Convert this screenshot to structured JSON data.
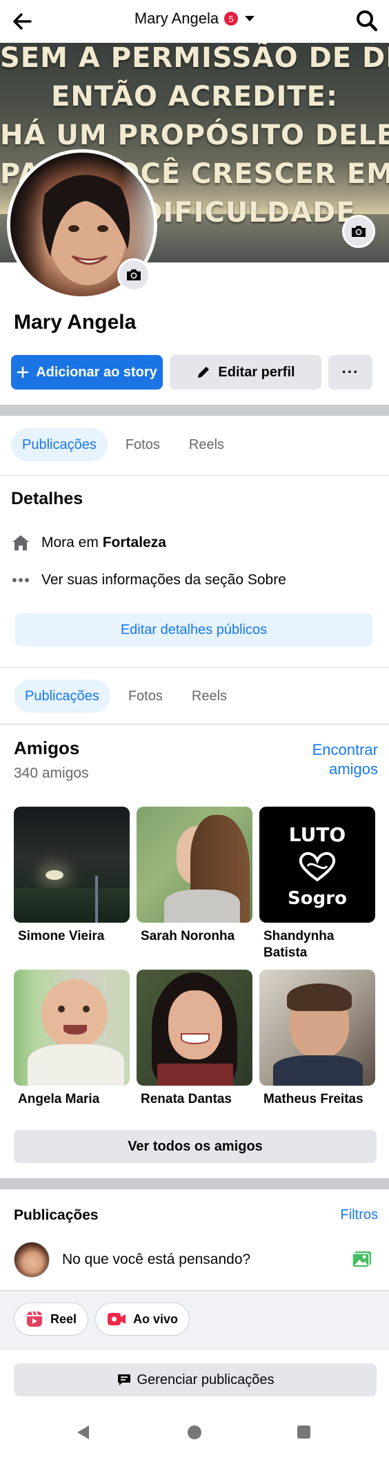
{
  "header": {
    "title": "Mary Angela",
    "notification_count": "5"
  },
  "cover": {
    "quote_lines": [
      "SEM A PERMISSÃO DE DEUS,",
      "ENTÃO ACREDITE:",
      "HÁ UM PROPÓSITO DELE",
      "PARA VOCÊ CRESCER EM",
      "DIFICULDADE."
    ]
  },
  "profile": {
    "name": "Mary Angela"
  },
  "actions": {
    "add_story": "Adicionar ao story",
    "edit_profile": "Editar perfil",
    "more": "···"
  },
  "tabs_top": [
    "Publicações",
    "Fotos",
    "Reels"
  ],
  "details": {
    "title": "Detalhes",
    "lives_in_prefix": "Mora em ",
    "lives_in_city": "Fortaleza",
    "about_link": "Ver suas informações da seção Sobre",
    "edit_button": "Editar detalhes públicos"
  },
  "tabs_mid": [
    "Publicações",
    "Fotos",
    "Reels"
  ],
  "friends": {
    "title": "Amigos",
    "count": "340 amigos",
    "find_link": "Encontrar amigos",
    "list": [
      {
        "name": "Simone Vieira"
      },
      {
        "name": "Sarah Noronha"
      },
      {
        "name": "Shandynha Batista"
      },
      {
        "name": "Angela Maria"
      },
      {
        "name": "Renata Dantas"
      },
      {
        "name": "Matheus Freitas"
      }
    ],
    "see_all": "Ver todos os amigos",
    "luto_lines": [
      "LUTO",
      "Sogro"
    ]
  },
  "posts": {
    "title": "Publicações",
    "filters": "Filtros",
    "composer_prompt": "No que você está pensando?",
    "reel": "Reel",
    "live": "Ao vivo",
    "manage": "Gerenciar publicações"
  },
  "colors": {
    "accent": "#1877f2",
    "primary_button": "#1b74e4",
    "badge": "#e41e3f"
  }
}
